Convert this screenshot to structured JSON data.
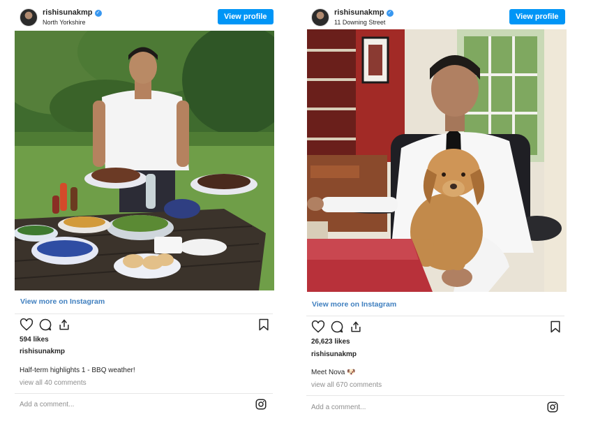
{
  "posts": [
    {
      "username": "rishisunakmp",
      "location": "North Yorkshire",
      "view_profile_label": "View profile",
      "view_more_label": "View more on Instagram",
      "likes": "594 likes",
      "owner": "rishisunakmp",
      "caption": "Half-term highlights 1 - BBQ weather!",
      "comments_link": "view all 40 comments",
      "comment_placeholder": "Add a comment..."
    },
    {
      "username": "rishisunakmp",
      "location": "11 Downing Street",
      "view_profile_label": "View profile",
      "view_more_label": "View more on Instagram",
      "likes": "26,623 likes",
      "owner": "rishisunakmp",
      "caption": "Meet Nova 🐶",
      "comments_link": "view all 670 comments",
      "comment_placeholder": "Add a comment..."
    }
  ],
  "colors": {
    "button_blue": "#0095f6",
    "link_blue": "#3f7fbf",
    "muted_gray": "#8e8e8e",
    "text": "#262626"
  },
  "icons": [
    "verified-badge-icon",
    "heart-icon",
    "comment-icon",
    "share-icon",
    "bookmark-icon",
    "instagram-icon"
  ]
}
